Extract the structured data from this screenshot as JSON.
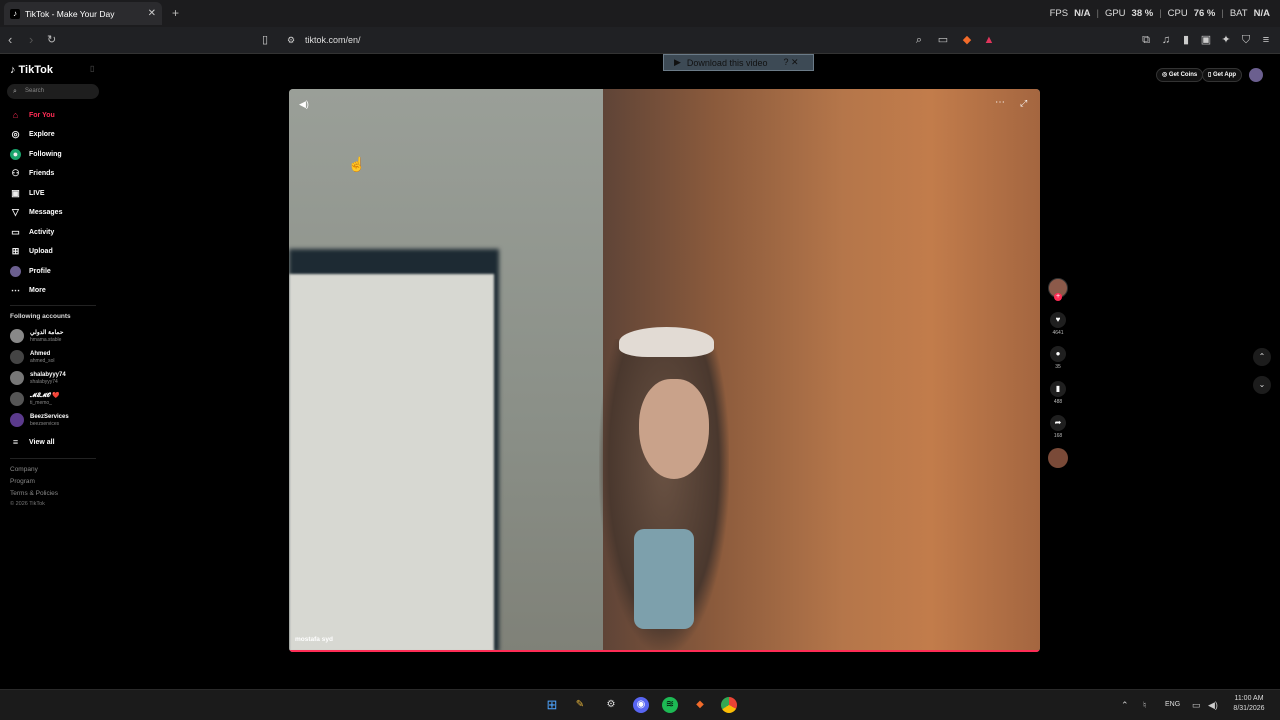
{
  "browser": {
    "tab_title": "TikTok - Make Your Day",
    "tab_close": "✕",
    "new_tab": "+",
    "url": "tiktok.com/en/",
    "perf": {
      "fps_label": "FPS",
      "fps_value": "N/A",
      "gpu_label": "GPU",
      "gpu_value": "38 %",
      "cpu_label": "CPU",
      "cpu_value": "76 %",
      "bat_label": "BAT",
      "bat_value": "N/A"
    }
  },
  "download_banner": {
    "label": "Download this video",
    "extra": "? ✕"
  },
  "sidebar": {
    "logo": "TikTok",
    "search_placeholder": "Search",
    "nav": [
      {
        "label": "For You",
        "icon": "home-icon"
      },
      {
        "label": "Explore",
        "icon": "compass-icon"
      },
      {
        "label": "Following",
        "icon": "following-icon"
      },
      {
        "label": "Friends",
        "icon": "friends-icon"
      },
      {
        "label": "LIVE",
        "icon": "live-icon"
      },
      {
        "label": "Messages",
        "icon": "messages-icon"
      },
      {
        "label": "Activity",
        "icon": "activity-icon"
      },
      {
        "label": "Upload",
        "icon": "upload-icon"
      },
      {
        "label": "Profile",
        "icon": "profile-icon"
      },
      {
        "label": "More",
        "icon": "more-icon"
      }
    ],
    "following_title": "Following accounts",
    "accounts": [
      {
        "name": "حمامة الدولي",
        "handle": "hmama.stable"
      },
      {
        "name": "Ahmed",
        "handle": "ahmed_sol"
      },
      {
        "name": "shalabyyy74",
        "handle": "shalabyyy74"
      },
      {
        "name": "𝓜𝓔𝓜𝓞 ❤️",
        "handle": "ti_memo_"
      },
      {
        "name": "BeezServices",
        "handle": "beezservices"
      }
    ],
    "view_all": "View all",
    "footer": [
      "Company",
      "Program",
      "Terms & Policies"
    ],
    "copyright": "© 2026 TikTok"
  },
  "header": {
    "get_coins": "Get Coins",
    "get_app": "Get App"
  },
  "video": {
    "author": "mostafa syd"
  },
  "actions": {
    "likes": "4641",
    "comments": "35",
    "saves": "488",
    "shares": "168"
  },
  "taskbar": {
    "lang": "ENG",
    "time": "11:00 AM",
    "date": "8/31/2026"
  }
}
